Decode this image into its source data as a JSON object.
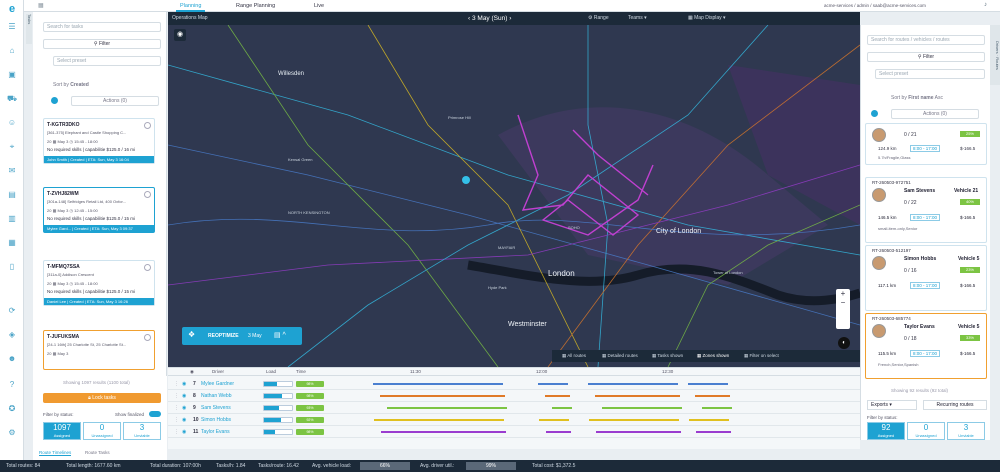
{
  "top": {
    "tabs": [
      {
        "label": "Planning"
      },
      {
        "label": "Range Planning"
      },
      {
        "label": "Live"
      }
    ],
    "user": "acme-services / admin / saab@acme-services.com"
  },
  "mapheader": {
    "title": "Operations Map",
    "date": "3 May (Sun)",
    "range": "Range",
    "teams": "Teams",
    "display": "Map Display"
  },
  "left": {
    "search_placeholder": "Search for tasks",
    "filter": "Filter",
    "preset": "Select preset",
    "sort": "Created",
    "actions": "Actions (0)",
    "cards": [
      {
        "title": "T-KGTR3DKO",
        "addr": "[361-375] Elephant and Castle Shopping C...",
        "qty": "20",
        "date": "May 3",
        "time": "15:45 - 18:00",
        "msg": "No required skills | capabilitie $125.0 / 16 mi",
        "footer": "John Smith | Created | ETA: Sun, May 3 16:04"
      },
      {
        "title": "T-ZVHJ82WM",
        "addr": "[301a-148] Selfridges Retail Ltd, 400 Oxfor...",
        "qty": "20",
        "date": "May 3",
        "time": "12:45 - 15:00",
        "msg": "No required skills | capabilitie $125.0 / 15 mi",
        "footer": "Mylee Gard... | Created | ETA: Sun, May 3 09:37"
      },
      {
        "title": "T-MFMQ7SSA",
        "addr": "[311a-0] Addison Crescent",
        "qty": "20",
        "date": "May 3",
        "time": "15:45 - 18:00",
        "msg": "No required skills | capabilitie $125.0 / 15 mi",
        "footer": "Daniel Lee | Created | ETA: Sun, May 3 16:26"
      },
      {
        "title": "T-JUFUKSMA",
        "addr": "[24-1 16th] 25 Charlotte St, 25 Charlotte St...",
        "qty": "20",
        "date": "May 3",
        "time": "",
        "msg": "",
        "footer": ""
      }
    ],
    "showing": "Showing 1097 results (1100 total)",
    "lock": "Lock tasks",
    "filter_status": "Filter by status:",
    "show_finalized": "Show finalized",
    "stats": [
      {
        "value": "1097",
        "label": "Assigned"
      },
      {
        "value": "0",
        "label": "Unassigned"
      },
      {
        "value": "3",
        "label": "Unviable"
      }
    ],
    "bottom_tabs": [
      "Route Timelines",
      "Route Tasks"
    ]
  },
  "map": {
    "labels": [
      "Willesden",
      "Primrose Hill",
      "Kensal Green",
      "Hyde Park",
      "London",
      "City of London",
      "Westminster",
      "NORTH KENSINGTON",
      "MAYFAIR",
      "SOHO",
      "Tower of London"
    ],
    "reoptimize": "REOPTIMIZE",
    "reopt_date": "3 May",
    "toolbar": [
      "All routes",
      "Detailed routes",
      "Tasks shown",
      "Zones shown",
      "Filter on select"
    ]
  },
  "right": {
    "search_placeholder": "Search for routes / vehicles / routes",
    "filter": "Filter",
    "preset": "Select preset",
    "sort": "First name",
    "actions": "Actions (0)",
    "routes": [
      {
        "id": "",
        "name": "",
        "vehicle": "",
        "load": "0 / 21",
        "pct": "25%",
        "dist": "124.9 km",
        "time": "8:00 - 17:00",
        "cost": "$-166.5",
        "tags": "5.7h/Fragile,Glass"
      },
      {
        "id": "RT-260503-972751",
        "name": "Sam Stevens",
        "vehicle": "Vehicle 21",
        "load": "0 / 22",
        "pct": "40%",
        "dist": "146.5 km",
        "time": "8:00 - 17:00",
        "cost": "$-166.5",
        "tags": "small-item-only,Senior"
      },
      {
        "id": "RT-260503-512197",
        "name": "Simon Hobbs",
        "vehicle": "Vehicle 5",
        "load": "0 / 16",
        "pct": "23%",
        "dist": "117.1 km",
        "time": "8:00 - 17:00",
        "cost": "$-166.5",
        "tags": ""
      },
      {
        "id": "RT-260503-685774",
        "name": "Taylor Evans",
        "vehicle": "Vehicle 5",
        "load": "0 / 18",
        "pct": "33%",
        "dist": "115.5 km",
        "time": "8:00 - 17:00",
        "cost": "$-166.5",
        "tags": "French,Senior,Spanish"
      }
    ],
    "showing": "Showing 92 results (92 total)",
    "exports": "Exports",
    "recurring": "Recurring routes",
    "filter_status": "Filter by status:",
    "stats": [
      {
        "value": "92",
        "label": "Assigned"
      },
      {
        "value": "0",
        "label": "Unassigned"
      },
      {
        "value": "3",
        "label": "Unviable"
      }
    ]
  },
  "timeline": {
    "cols": [
      "Driver",
      "Load",
      "Time"
    ],
    "times": [
      "11:30",
      "12:00",
      "12:30"
    ],
    "rows": [
      {
        "no": "7",
        "name": "Mylee Gardner",
        "load": 0.45,
        "time": "98%",
        "color": "#4a7fd0"
      },
      {
        "no": "8",
        "name": "Nathan Webb",
        "load": 0.65,
        "time": "98%",
        "color": "#e07a28"
      },
      {
        "no": "9",
        "name": "Sam Stevens",
        "load": 0.55,
        "time": "93%",
        "color": "#7cc443"
      },
      {
        "no": "10",
        "name": "Simon Hobbs",
        "load": 0.6,
        "time": "92%",
        "color": "#e0c020"
      },
      {
        "no": "11",
        "name": "Taylor Evans",
        "load": 0.4,
        "time": "98%",
        "color": "#9a3ccf"
      }
    ]
  },
  "status": {
    "total_routes": "Total routes: 84",
    "total_length": "Total length: 1677.60 km",
    "total_duration": "Total duration: 107:00h",
    "tasks_h": "Tasks/h: 1.84",
    "tasks_route": "Tasks/route: 16.42",
    "vehicle_load": "Avg. vehicle load:",
    "vehicle_load_val": "66%",
    "driver_util": "Avg. driver util.:",
    "driver_util_val": "99%",
    "total_cost": "Total cost: $1,372.5"
  }
}
